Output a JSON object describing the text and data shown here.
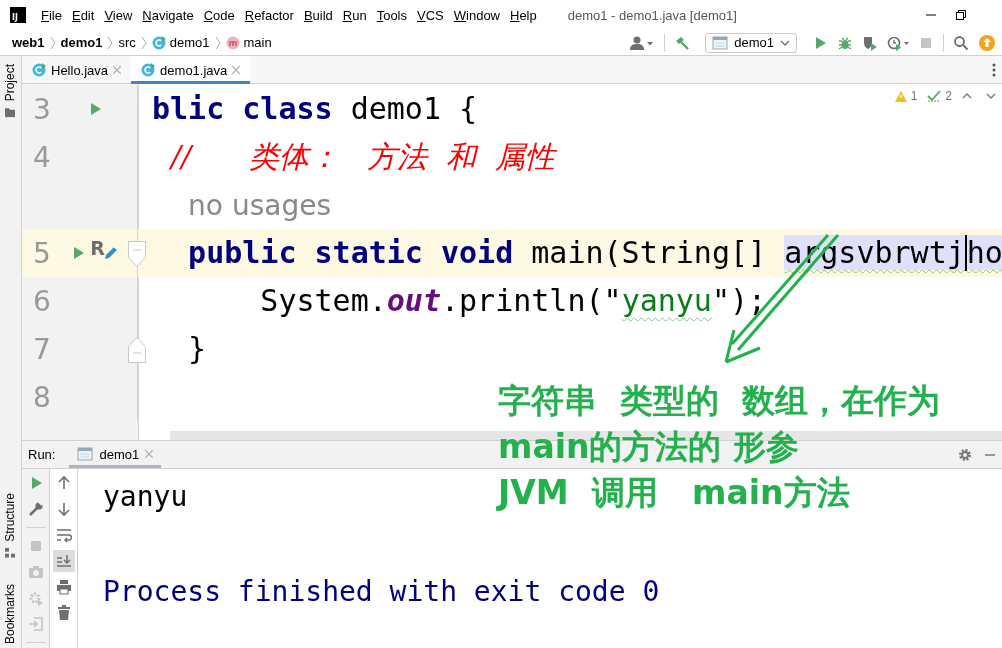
{
  "window": {
    "logo": "IJ",
    "title": "demo1 - demo1.java [demo1]"
  },
  "menu": [
    "File",
    "Edit",
    "View",
    "Navigate",
    "Code",
    "Refactor",
    "Build",
    "Run",
    "Tools",
    "VCS",
    "Window",
    "Help"
  ],
  "breadcrumbs": [
    {
      "label": "web1",
      "kind": "project"
    },
    {
      "label": "demo1",
      "kind": "module"
    },
    {
      "label": "src",
      "kind": "folder"
    },
    {
      "label": "demo1",
      "kind": "class"
    },
    {
      "label": "main",
      "kind": "method"
    }
  ],
  "toolbar": {
    "run_config": "demo1"
  },
  "side_tabs": [
    {
      "label": "Project"
    },
    {
      "label": "Structure"
    },
    {
      "label": "Bookmarks"
    }
  ],
  "editor_tabs": [
    {
      "label": "Hello.java",
      "selected": false
    },
    {
      "label": "demo1.java",
      "selected": true
    }
  ],
  "inspections": {
    "warnings": "1",
    "weak_warnings": "2"
  },
  "lines": [
    {
      "kind": "code",
      "number": "3",
      "current": false,
      "run_button": true,
      "edit_button": false,
      "fold_start": false,
      "fold_end": false,
      "tokens": [
        {
          "text": "blic class",
          "kind": "keyword",
          "typo": false
        },
        {
          "text": " demo1 {",
          "kind": "plain",
          "typo": false
        }
      ]
    },
    {
      "kind": "code",
      "number": "4",
      "current": false,
      "run_button": false,
      "edit_button": false,
      "fold_start": false,
      "fold_end": false,
      "tokens": [
        {
          "text": "  //      类体：   方法  和  属性",
          "kind": "comment",
          "typo": false
        }
      ]
    },
    {
      "kind": "hint",
      "text": "no usages"
    },
    {
      "kind": "code",
      "number": "5",
      "current": true,
      "run_button": true,
      "edit_button": true,
      "gutter_label": "R",
      "fold_start": true,
      "fold_end": false,
      "tokens": [
        {
          "text": "  public static void",
          "kind": "keyword",
          "typo": false
        },
        {
          "text": " main(String[] ",
          "kind": "plain",
          "typo": false
        },
        {
          "text": "argsvbrwtj",
          "kind": "param",
          "typo": true,
          "caret_after": true
        },
        {
          "text": "ho",
          "kind": "param",
          "typo": true
        }
      ]
    },
    {
      "kind": "code",
      "number": "6",
      "current": false,
      "run_button": false,
      "edit_button": false,
      "fold_start": false,
      "fold_end": false,
      "tokens": [
        {
          "text": "      System.",
          "kind": "plain",
          "typo": false
        },
        {
          "text": "out",
          "kind": "field",
          "typo": false
        },
        {
          "text": ".println(\"",
          "kind": "plain",
          "typo": false
        },
        {
          "text": "yanyu",
          "kind": "string",
          "typo": true
        },
        {
          "text": "\");",
          "kind": "plain",
          "typo": false
        }
      ]
    },
    {
      "kind": "code",
      "number": "7",
      "current": false,
      "run_button": false,
      "edit_button": false,
      "fold_start": false,
      "fold_end": true,
      "tokens": [
        {
          "text": "  }",
          "kind": "plain",
          "typo": false
        }
      ]
    },
    {
      "kind": "code",
      "number": "8",
      "current": false,
      "run_button": false,
      "edit_button": false,
      "fold_start": false,
      "fold_end": false
    }
  ],
  "run_panel": {
    "label": "Run:",
    "tab": "demo1",
    "output": [
      {
        "text": "yanyu",
        "kind": "stdout"
      },
      {
        "text": "Process finished with exit code 0",
        "kind": "system"
      }
    ]
  },
  "annotation": {
    "lines": [
      "字符串  类型的  数组，在作为",
      "main的方法的 形参",
      "JVM  调用   main方法"
    ]
  }
}
